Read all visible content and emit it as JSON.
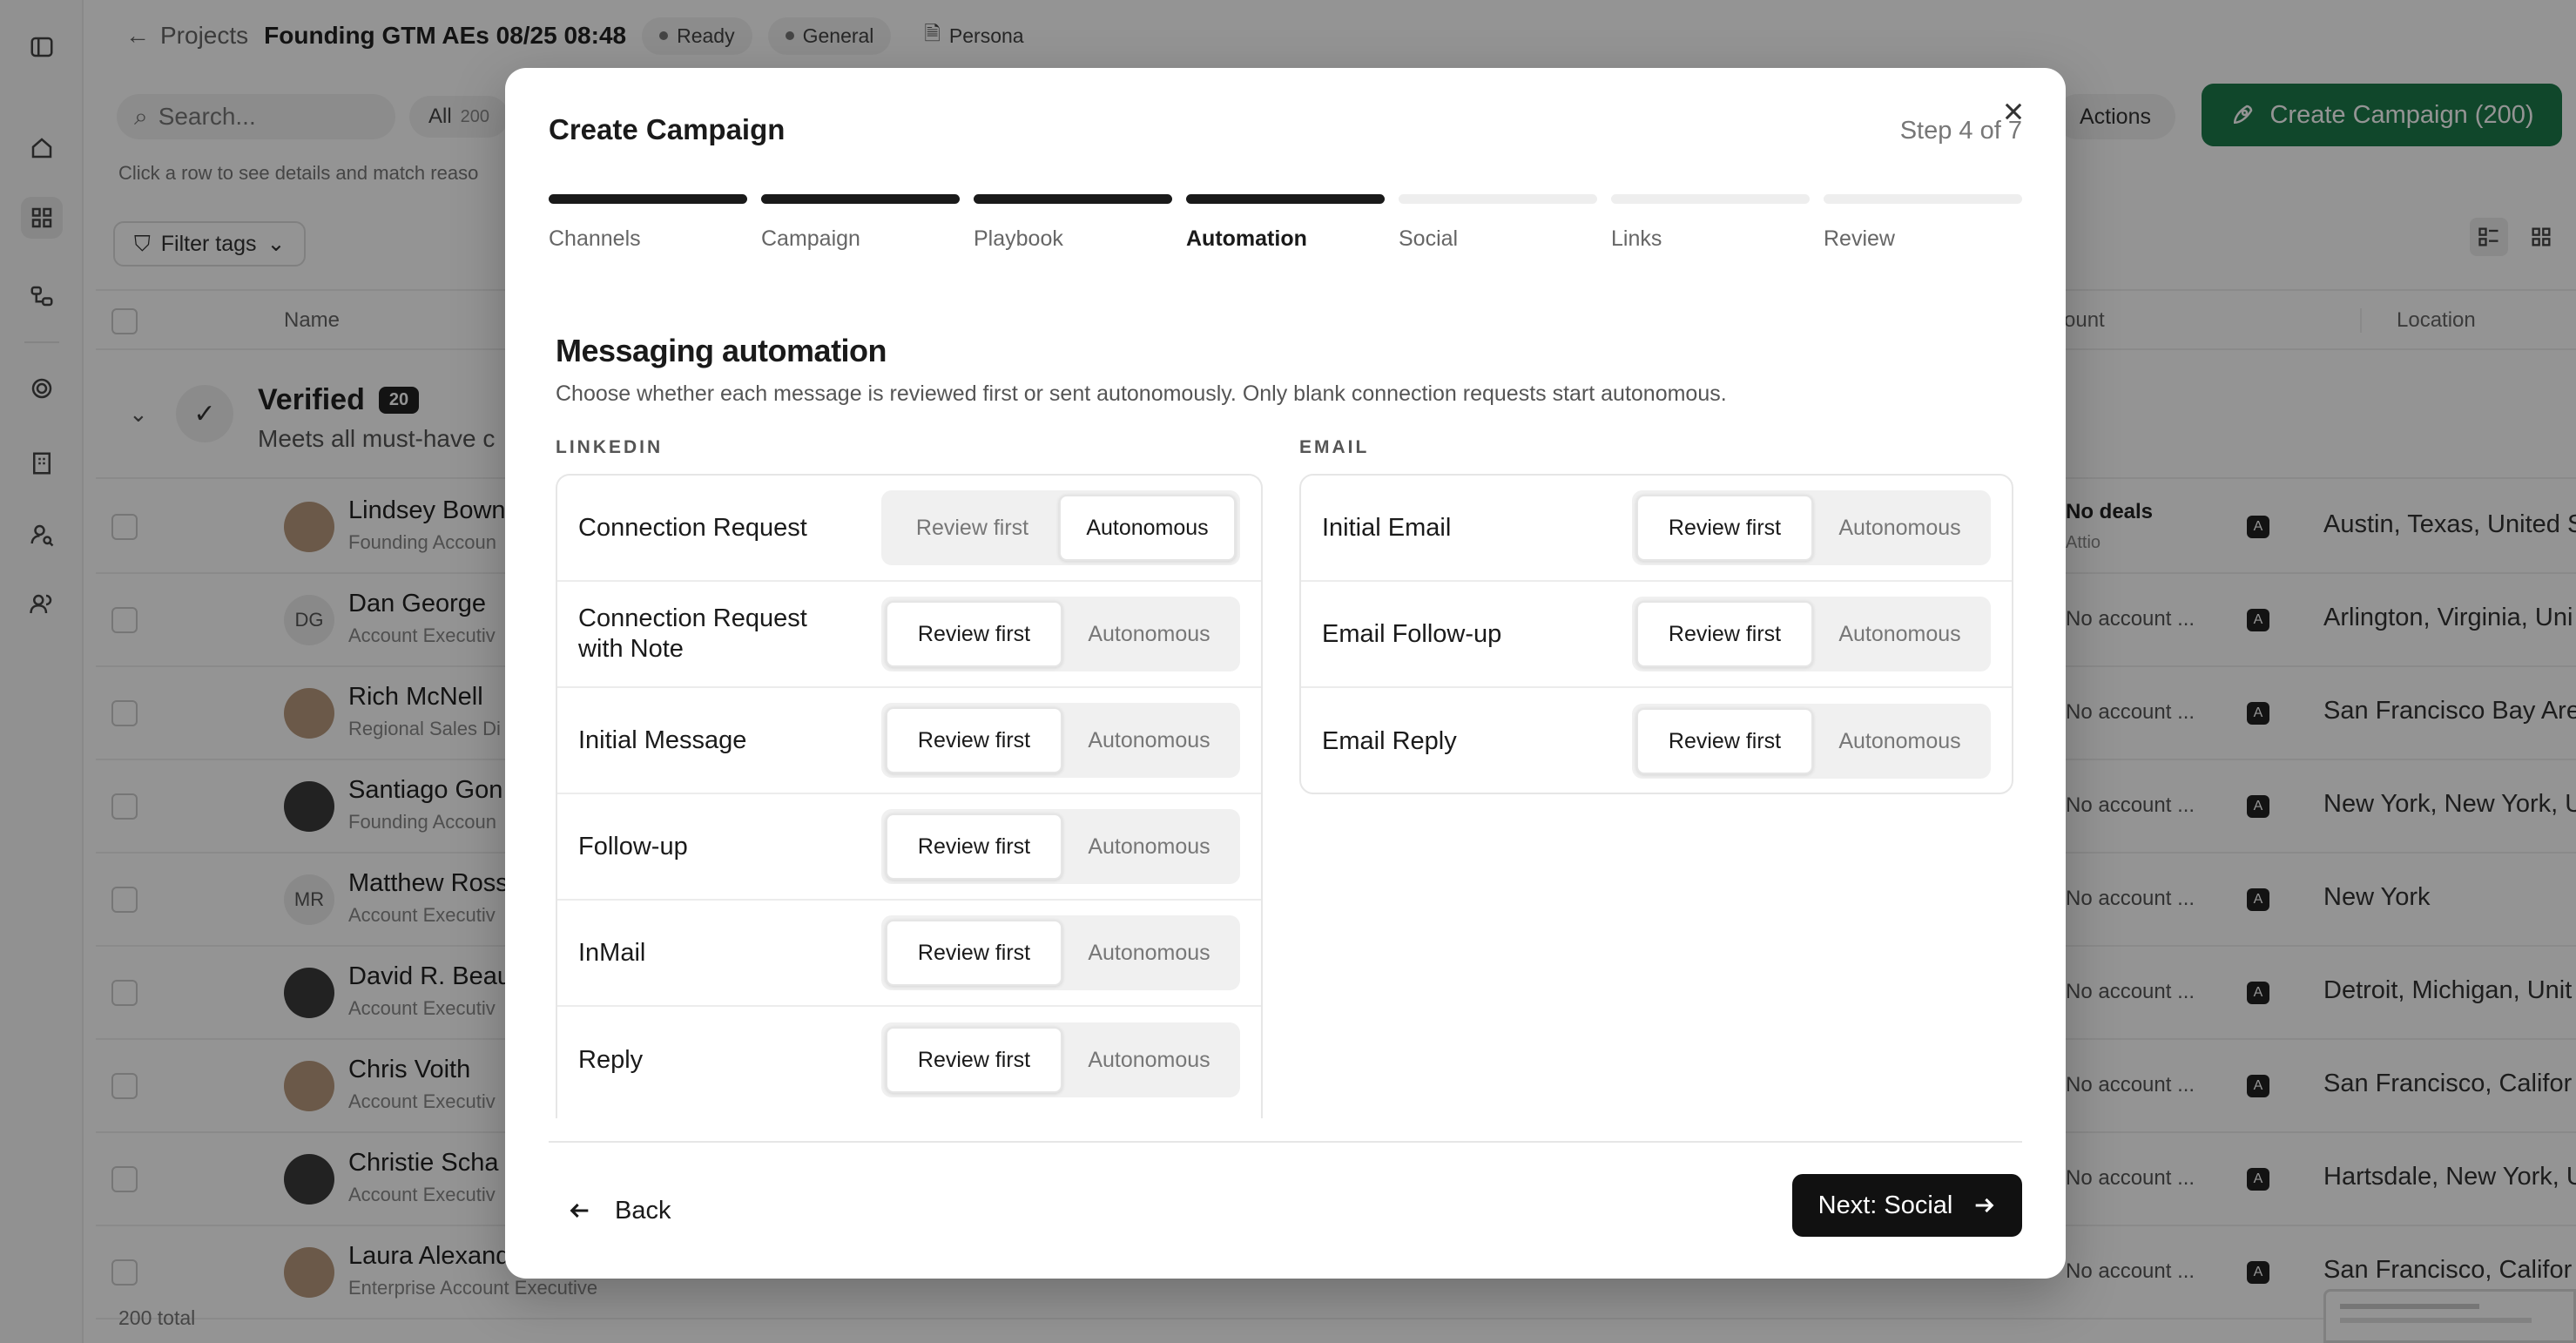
{
  "topbar": {
    "back_label": "Projects",
    "project_title": "Founding GTM AEs 08/25 08:48",
    "status": "Ready",
    "category": "General",
    "persona": "Persona"
  },
  "toolbar": {
    "search_placeholder": "Search...",
    "all_label": "All",
    "all_count": "200",
    "hint": "Click a row to see details and match reaso",
    "filter_tags": "Filter tags",
    "actions": "Actions",
    "create_campaign": "Create Campaign  (200)"
  },
  "table": {
    "col_name": "Name",
    "col_count": "ount",
    "col_location": "Location",
    "group": {
      "title": "Verified",
      "count": "20",
      "desc": "Meets all must-have c"
    },
    "rows": [
      {
        "name": "Lindsey Bown",
        "title": "Founding Accoun",
        "count": "No deals",
        "count_sub": "Attio",
        "location": "Austin, Texas, United S",
        "avatar": ""
      },
      {
        "name": "Dan George",
        "title": "Account Executiv",
        "count": "No account ...",
        "location": "Arlington, Virginia, Uni",
        "avatar": "DG"
      },
      {
        "name": "Rich McNell",
        "title": "Regional Sales Di",
        "count": "No account ...",
        "location": "San Francisco Bay Are",
        "avatar": ""
      },
      {
        "name": "Santiago Gon",
        "title": "Founding Accoun",
        "count": "No account ...",
        "location": "New York, New York, U",
        "avatar": ""
      },
      {
        "name": "Matthew Ross",
        "title": "Account Executiv",
        "count": "No account ...",
        "location": "New York",
        "avatar": "MR"
      },
      {
        "name": "David R. Beau",
        "title": "Account Executiv",
        "count": "No account ...",
        "location": "Detroit, Michigan, Unit",
        "avatar": ""
      },
      {
        "name": "Chris Voith",
        "title": "Account Executiv",
        "count": "No account ...",
        "location": "San Francisco, Califor",
        "avatar": ""
      },
      {
        "name": "Christie Scha",
        "title": "Account Executiv",
        "count": "No account ...",
        "location": "Hartsdale, New York, U",
        "avatar": ""
      },
      {
        "name": "Laura Alexand",
        "title": "Enterprise Account Executive",
        "count": "No account ...",
        "location": "San Francisco, Califor",
        "avatar": ""
      }
    ],
    "total": "200 total"
  },
  "modal": {
    "title": "Create Campaign",
    "step_text": "Step 4 of 7",
    "steps": [
      "Channels",
      "Campaign",
      "Playbook",
      "Automation",
      "Social",
      "Links",
      "Review"
    ],
    "current_step": 4,
    "section_title": "Messaging automation",
    "section_desc": "Choose whether each message is reviewed first or sent autonomously. Only blank connection requests start autonomous.",
    "option_review": "Review first",
    "option_auto": "Autonomous",
    "linkedin": {
      "heading": "LINKEDIN",
      "items": [
        {
          "label": "Connection Request",
          "selected": "Autonomous"
        },
        {
          "label": "Connection Request with Note",
          "selected": "Review first"
        },
        {
          "label": "Initial Message",
          "selected": "Review first"
        },
        {
          "label": "Follow-up",
          "selected": "Review first"
        },
        {
          "label": "InMail",
          "selected": "Review first"
        },
        {
          "label": "Reply",
          "selected": "Review first"
        }
      ]
    },
    "email": {
      "heading": "EMAIL",
      "items": [
        {
          "label": "Initial Email",
          "selected": "Review first"
        },
        {
          "label": "Email Follow-up",
          "selected": "Review first"
        },
        {
          "label": "Email Reply",
          "selected": "Review first"
        }
      ]
    },
    "back_label": "Back",
    "next_label": "Next: Social"
  }
}
